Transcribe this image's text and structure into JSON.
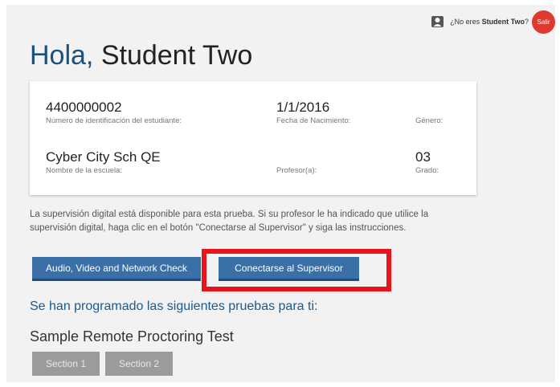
{
  "header": {
    "not_you_prefix": "¿No eres ",
    "student_name": "Student Two",
    "not_you_suffix": "?",
    "logout_label": "Salir"
  },
  "greeting": {
    "hello": "Hola,",
    "name": "Student Two"
  },
  "student_info": {
    "student_id": "4400000002",
    "student_id_label": "Número de identificación del estudiante:",
    "birth_date": "1/1/2016",
    "birth_date_label": "Fecha de Nacimiento:",
    "gender_value": "",
    "gender_label": "Género:",
    "school_name": "Cyber City Sch QE",
    "school_label": "Nombre de la escuela:",
    "teacher_value": "",
    "teacher_label": "Profesor(a):",
    "grade": "03",
    "grade_label": "Grado:"
  },
  "notice": "La supervisión digital está disponible para esta prueba. Si su profesor le ha indicado que utilice la supervisión digital, haga clic en el botón \"Conectarse al Supervisor\" y siga las instrucciones.",
  "buttons": {
    "check_label": "Audio, Video and Network Check",
    "proctor_label": "Conectarse al Supervisor"
  },
  "scheduled_heading": "Se han programado las siguientes pruebas para ti:",
  "test": {
    "title": "Sample Remote Proctoring Test",
    "sections": [
      "Section 1",
      "Section 2"
    ]
  },
  "colors": {
    "accent_blue": "#3a6fa8",
    "heading_blue": "#1b4f80",
    "logout_red": "#e03a2e",
    "highlight_red": "#e8141c",
    "section_gray": "#9b9b9b"
  }
}
